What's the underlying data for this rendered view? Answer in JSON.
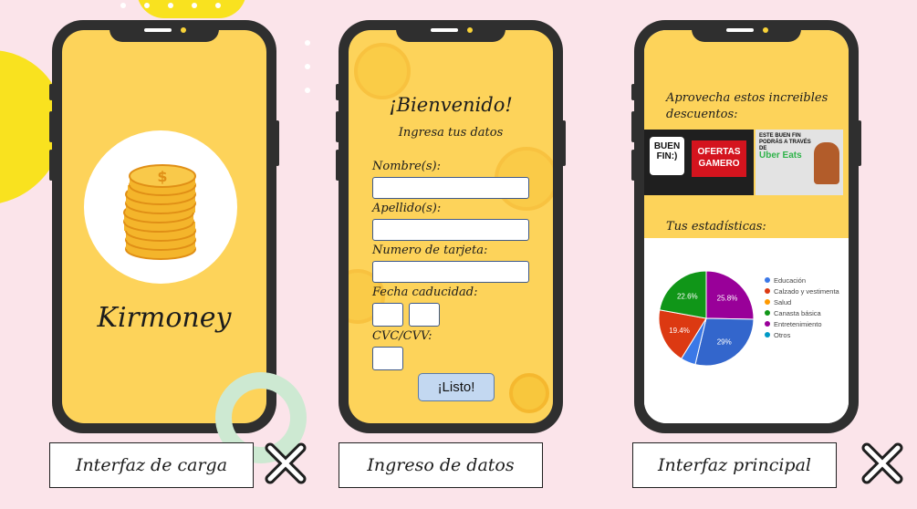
{
  "screens": {
    "loading": {
      "app_name": "Kirmoney",
      "caption": "Interfaz de carga"
    },
    "form": {
      "welcome": "¡Bienvenido!",
      "subtitle": "Ingresa tus datos",
      "label_name": "Nombre(s):",
      "label_lastname": "Apellido(s):",
      "label_card": "Numero de tarjeta:",
      "label_expiry": "Fecha caducidad:",
      "label_cvc": "CVC/CVV:",
      "submit": "¡Listo!",
      "caption": "Ingreso de datos"
    },
    "main": {
      "promo": "Aprovecha estos increibles descuentos:",
      "banner1_logo": "BUEN FIN:)",
      "banner1_offer": "OFERTAS GAMERO",
      "banner2_text": "ESTE BUEN FIN PODRÁS A TRAVÉS DE",
      "banner2_brand": "Uber Eats",
      "stats_title": "Tus estadísticas:",
      "caption": "Interfaz principal"
    }
  },
  "chart_data": {
    "type": "pie",
    "series": [
      {
        "name": "Educación",
        "value": 5.2,
        "color": "#3b78e7"
      },
      {
        "name": "Calzado y vestimenta",
        "value": 19.4,
        "color": "#dc3912"
      },
      {
        "name": "Salud",
        "value": 0,
        "color": "#ff9900"
      },
      {
        "name": "Canasta básica",
        "value": 22.6,
        "color": "#109618"
      },
      {
        "name": "Entretenimiento",
        "value": 25.8,
        "color": "#990099"
      },
      {
        "name": "Otros",
        "value": 29,
        "color": "#3366cc"
      }
    ],
    "labels": [
      {
        "text": "25.8%"
      },
      {
        "text": "22.6%"
      },
      {
        "text": "19.4%"
      },
      {
        "text": "29%"
      }
    ],
    "legend": [
      "Educación",
      "Calzado y vestimenta",
      "Salud",
      "Canasta básica",
      "Entretenimiento",
      "Otros"
    ],
    "legend_colors": [
      "#3b78e7",
      "#dc3912",
      "#ff9900",
      "#109618",
      "#990099",
      "#0099c6"
    ]
  }
}
